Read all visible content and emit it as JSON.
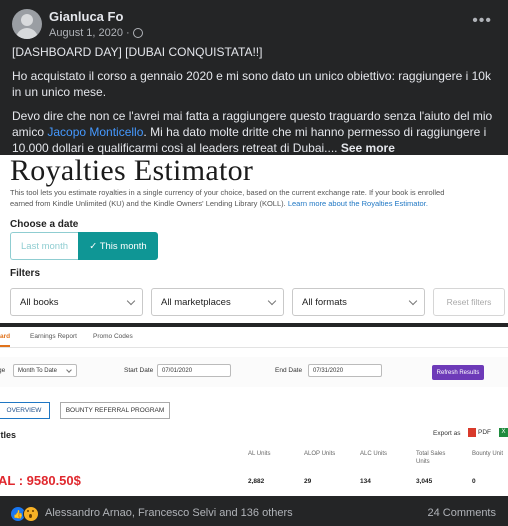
{
  "post": {
    "author": "Gianluca Fo",
    "date": "August 1, 2020",
    "separator": "·",
    "privacy_icon": "globe-icon",
    "more_icon": "ellipsis-icon",
    "more_label": "•••",
    "title_line": "[DASHBOARD DAY] [DUBAI CONQUISTATA!!]",
    "para1": "Ho acquistato il corso a gennaio 2020 e mi sono dato un unico obiettivo: raggiungere i 10k in un unico mese.",
    "para2_a": "Devo dire che non ce l'avrei mai fatta a raggiungere questo traguardo senza l'aiuto del mio amico ",
    "para2_link": "Jacopo Monticello",
    "para2_b": ". Mi ha dato molte dritte che mi hanno permesso di raggiungere i 10.000 dollari e qualificarmi così al leaders retreat di Dubai....",
    "see_more": " See more"
  },
  "royalties": {
    "title": "Royalties Estimator",
    "desc_line1": "This tool lets you estimate royalties in a single currency of your choice, based on the current exchange rate. If your book is enrolled",
    "desc_line2": "earned from Kindle Unlimited (KU) and the Kindle Owners' Lending Library (KOLL). ",
    "desc_link": "Learn more about the Royalties Estimator.",
    "choose_date": "Choose a date",
    "last_month": "Last month",
    "this_month": "✓ This month",
    "filters_label": "Filters",
    "filter_books": "All books",
    "filter_marketplaces": "All marketplaces",
    "filter_formats": "All formats",
    "reset_filters": "Reset filters"
  },
  "dashboard": {
    "tab_dashboard": "oard",
    "tab_earnings": "Earnings Report",
    "tab_promo": "Promo Codes",
    "range_label": "ge",
    "range_value": "Month To Date",
    "start_label": "Start Date",
    "start_value": "07/01/2020",
    "end_label": "End Date",
    "end_value": "07/31/2020",
    "refresh_button": "Refresh Results",
    "overview_button": "OVERVIEW",
    "bounty_button": "BOUNTY REFERRAL PROGRAM",
    "section_title": "ltles",
    "export_label": "Export as",
    "pdf_label": "PDF",
    "xls_label": "X",
    "columns": [
      "AL Units",
      "ALOP Units",
      "ALC Units",
      "Total Sales",
      "Bounty Unit"
    ],
    "columns_line2": [
      "",
      "",
      "",
      "Units",
      ""
    ],
    "values": [
      "2,882",
      "29",
      "134",
      "3,045",
      "0"
    ],
    "royalty_total": "AL : 9580.50$"
  },
  "footer": {
    "reaction_icons": [
      "like-icon",
      "wow-icon"
    ],
    "reactions_text": "Alessandro Arnao, Francesco Selvi and 136 others",
    "comments_text": "24 Comments"
  },
  "colors": {
    "background": "#242526",
    "text": "#e4e6eb",
    "link": "#4599ff",
    "teal": "#0f9695",
    "refresh_purple": "#6d3ab8",
    "total_red": "#e0282e"
  }
}
